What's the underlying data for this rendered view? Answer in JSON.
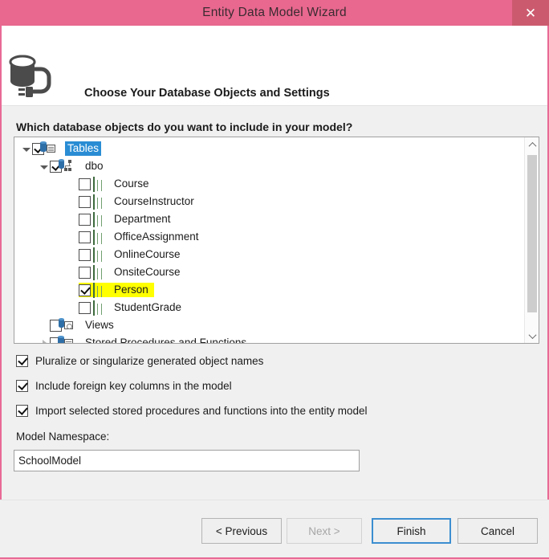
{
  "titlebar": {
    "title": "Entity Data Model Wizard",
    "close_label": "✕",
    "close_icon": "close-icon",
    "bg_color": "#e8688f",
    "close_bg_color": "#cc5a6e"
  },
  "header": {
    "icon": "database-connection-icon",
    "title": "Choose Your Database Objects and Settings"
  },
  "body": {
    "question": "Which database objects do you want to include in your model?"
  },
  "tree": {
    "selection_color": "#2a8dd4",
    "highlight_color": "#ffff00",
    "nodes": [
      {
        "label": "Tables",
        "indent": 0,
        "checked": true,
        "expander": "down",
        "icon": "tables-icon",
        "selected": true,
        "highlight": false
      },
      {
        "label": "dbo",
        "indent": 1,
        "checked": true,
        "expander": "down",
        "icon": "schema-icon",
        "selected": false,
        "highlight": false
      },
      {
        "label": "Course",
        "indent": 2,
        "checked": false,
        "expander": "none",
        "icon": "table-icon",
        "selected": false,
        "highlight": false
      },
      {
        "label": "CourseInstructor",
        "indent": 2,
        "checked": false,
        "expander": "none",
        "icon": "table-icon",
        "selected": false,
        "highlight": false
      },
      {
        "label": "Department",
        "indent": 2,
        "checked": false,
        "expander": "none",
        "icon": "table-icon",
        "selected": false,
        "highlight": false
      },
      {
        "label": "OfficeAssignment",
        "indent": 2,
        "checked": false,
        "expander": "none",
        "icon": "table-icon",
        "selected": false,
        "highlight": false
      },
      {
        "label": "OnlineCourse",
        "indent": 2,
        "checked": false,
        "expander": "none",
        "icon": "table-icon",
        "selected": false,
        "highlight": false
      },
      {
        "label": "OnsiteCourse",
        "indent": 2,
        "checked": false,
        "expander": "none",
        "icon": "table-icon",
        "selected": false,
        "highlight": false
      },
      {
        "label": "Person",
        "indent": 2,
        "checked": true,
        "expander": "none",
        "icon": "table-icon",
        "selected": false,
        "highlight": true
      },
      {
        "label": "StudentGrade",
        "indent": 2,
        "checked": false,
        "expander": "none",
        "icon": "table-icon",
        "selected": false,
        "highlight": false
      },
      {
        "label": "Views",
        "indent": 1,
        "checked": false,
        "expander": "none",
        "icon": "views-icon",
        "selected": false,
        "highlight": false
      },
      {
        "label": "Stored Procedures and Functions",
        "indent": 1,
        "checked": false,
        "expander": "right",
        "icon": "procedures-icon",
        "selected": false,
        "highlight": false
      }
    ]
  },
  "options": [
    {
      "label": "Pluralize or singularize generated object names",
      "checked": true
    },
    {
      "label": "Include foreign key columns in the model",
      "checked": true
    },
    {
      "label": "Import selected stored procedures and functions into the entity model",
      "checked": true
    }
  ],
  "namespace": {
    "label": "Model Namespace:",
    "value": "SchoolModel"
  },
  "footer": {
    "previous": "< Previous",
    "next": "Next >",
    "finish": "Finish",
    "cancel": "Cancel",
    "focus_color": "#3c8ed0"
  }
}
